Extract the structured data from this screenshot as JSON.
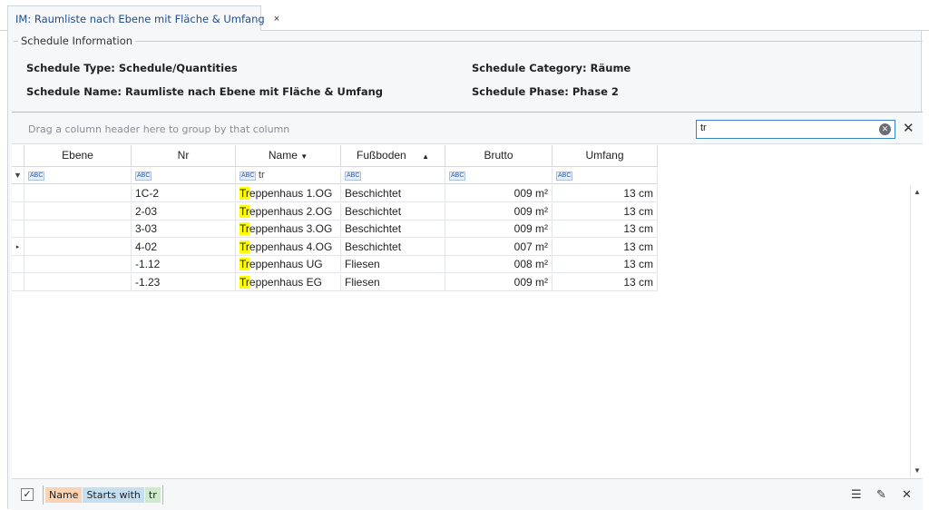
{
  "tab": {
    "title": "IM: Raumliste nach Ebene mit Fläche & Umfang",
    "close": "×"
  },
  "info": {
    "legend": "Schedule Information",
    "type": "Schedule Type: Schedule/Quantities",
    "name": "Schedule Name: Raumliste nach Ebene mit Fläche & Umfang",
    "category": "Schedule Category: Räume",
    "phase": "Schedule Phase: Phase 2"
  },
  "grid": {
    "group_hint": "Drag a column header here to group by that column",
    "search_value": "tr",
    "search_clear_icon": "⊗",
    "close_icon": "✕",
    "columns": [
      "Ebene",
      "Nr",
      "Name",
      "Fußboden",
      "Brutto",
      "Umfang"
    ],
    "sort_indicator": "▲",
    "filter_icon": "▼",
    "filter_row": {
      "name_value": "tr",
      "abc": "ABC"
    },
    "rows": [
      {
        "ebene": "",
        "nr": "1C-2",
        "name_hl": "Tr",
        "name_rest": "eppenhaus 1.OG",
        "fussboden": "Beschichtet",
        "brutto": "009 m²",
        "umfang": "13 cm"
      },
      {
        "ebene": "",
        "nr": "2-03",
        "name_hl": "Tr",
        "name_rest": "eppenhaus 2.OG",
        "fussboden": "Beschichtet",
        "brutto": "009 m²",
        "umfang": "13 cm"
      },
      {
        "ebene": "",
        "nr": "3-03",
        "name_hl": "Tr",
        "name_rest": "eppenhaus 3.OG",
        "fussboden": "Beschichtet",
        "brutto": "009 m²",
        "umfang": "13 cm"
      },
      {
        "ebene": "",
        "nr": "4-02",
        "name_hl": "Tr",
        "name_rest": "eppenhaus 4.OG",
        "fussboden": "Beschichtet",
        "brutto": "007 m²",
        "umfang": "13 cm"
      },
      {
        "ebene": "",
        "nr": "-1.12",
        "name_hl": "Tr",
        "name_rest": "eppenhaus UG",
        "fussboden": "Fliesen",
        "brutto": "008 m²",
        "umfang": "13 cm"
      },
      {
        "ebene": "",
        "nr": "-1.23",
        "name_hl": "Tr",
        "name_rest": "eppenhaus EG",
        "fussboden": "Fliesen",
        "brutto": "009 m²",
        "umfang": "13 cm"
      }
    ],
    "current_row_indicator": "▸"
  },
  "footer": {
    "checked": "✓",
    "filter_field": "Name",
    "filter_operator": "Starts with",
    "filter_value": "tr",
    "icons": {
      "customize": "☰",
      "edit": "✎",
      "clear": "✕"
    }
  },
  "colors": {
    "accent": "#1f4e8c",
    "highlight": "#ffff00"
  }
}
